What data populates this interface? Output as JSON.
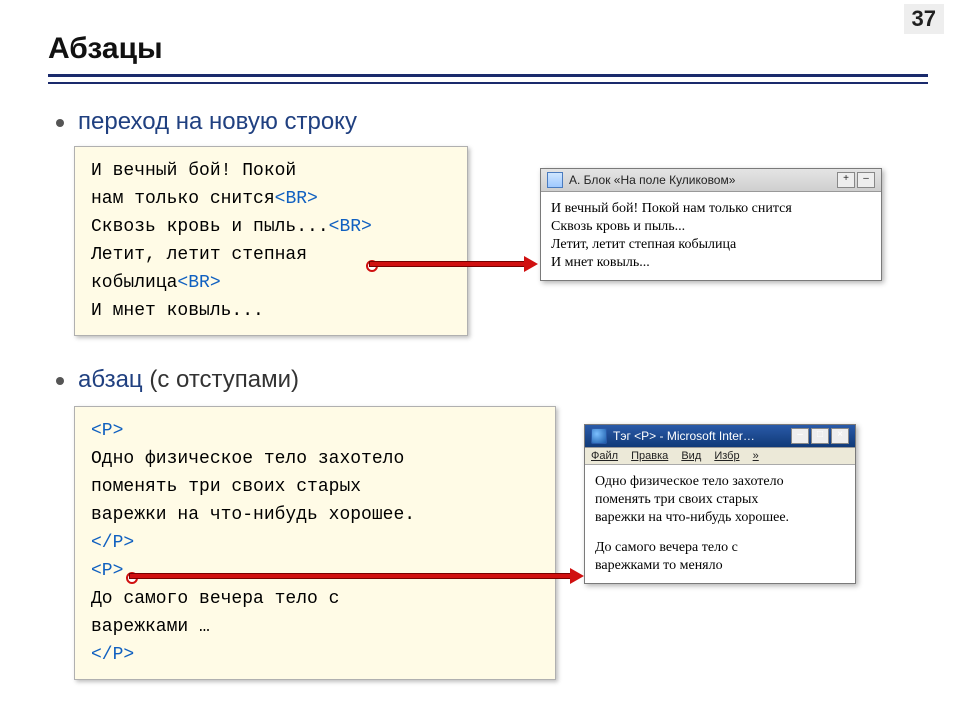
{
  "page_number": "37",
  "title": "Абзацы",
  "bullet1": {
    "text_plain": "переход на новую строку",
    "text_em": "переход на новую строку"
  },
  "bullet2": {
    "em": "абзац",
    "rest": " (с отступами)"
  },
  "code1": {
    "l1": "И вечный бой! Покой",
    "l2a": "нам только снится",
    "l2tag": "<BR>",
    "l3a": "Сквозь кровь и пыль...",
    "l3tag": "<BR>",
    "l4": "Летит, летит степная",
    "l5a": "кобылица",
    "l5tag": "<BR>",
    "l6": "И мнет ковыль..."
  },
  "win1": {
    "title": "А. Блок  «На поле Куликовом»",
    "line1": "И вечный бой! Покой нам только снится",
    "line2": "Сквозь кровь и пыль...",
    "line3": "Летит, летит степная кобылица",
    "line4": "И мнет ковыль..."
  },
  "code2": {
    "open": "<P>",
    "l1": "Одно физическое тело захотело",
    "l2": "поменять три своих старых",
    "l3": "варежки на что-нибудь хорошее.",
    "close": "</P>",
    "open2": "<P>",
    "l4": "До самого вечера тело с",
    "l5": "варежками …",
    "close2": "</P>"
  },
  "win2": {
    "title": "Тэг <P> - Microsoft Inter…",
    "menu": {
      "file": "Файл",
      "edit": "Правка",
      "view": "Вид",
      "fav": "Избр",
      "more": "»"
    },
    "para1_l1": "Одно физическое тело захотело",
    "para1_l2": "поменять три своих старых",
    "para1_l3": "варежки на что-нибудь хорошее.",
    "para2_l1": "До самого вечера тело с",
    "para2_l2": "варежками то меняло"
  },
  "winctl": {
    "min": "–",
    "max": "□",
    "close": "×",
    "plus": "+"
  }
}
